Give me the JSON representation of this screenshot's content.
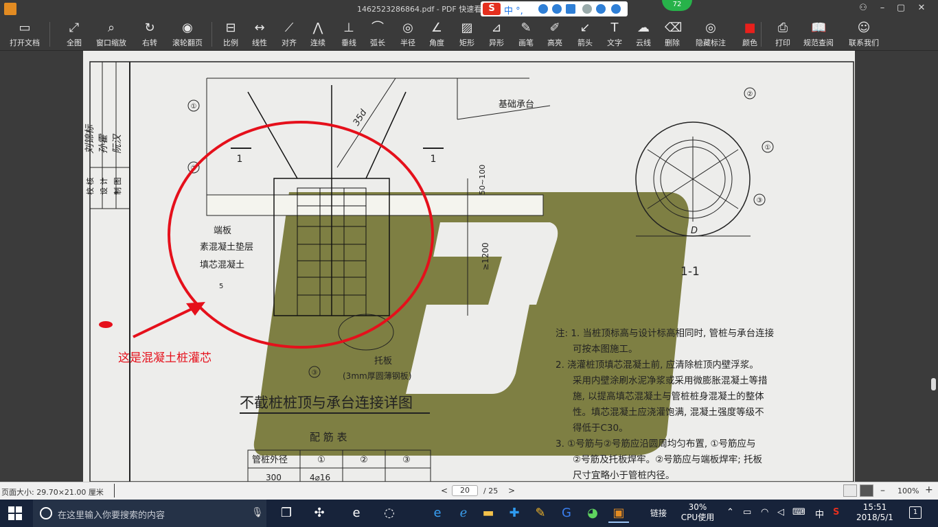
{
  "window": {
    "title": "1462523286864.pdf - PDF 快速看图",
    "badge_number": "72",
    "minimize_label": "–",
    "maximize_label": "▢",
    "close_label": "✕"
  },
  "ime": {
    "logo": "S",
    "mode": "中 °,"
  },
  "toolbar": {
    "buttons": [
      {
        "icon": "folder-icon",
        "glyph": "▭",
        "label": "打开文档"
      },
      {
        "icon": "fullview-icon",
        "glyph": "⤢",
        "label": "全图"
      },
      {
        "icon": "zoom-window-icon",
        "glyph": "⌕",
        "label": "窗口缩放"
      },
      {
        "icon": "rotate-icon",
        "glyph": "↻",
        "label": "右转"
      },
      {
        "icon": "mouse-icon",
        "glyph": "◉",
        "label": "滚轮翻页"
      },
      {
        "icon": "ruler-icon",
        "glyph": "⊟",
        "label": "比例"
      },
      {
        "icon": "linear-icon",
        "glyph": "↔",
        "label": "线性"
      },
      {
        "icon": "align-icon",
        "glyph": "⟋",
        "label": "对齐"
      },
      {
        "icon": "continuous-icon",
        "glyph": "⋀",
        "label": "连续"
      },
      {
        "icon": "perpendicular-icon",
        "glyph": "⊥",
        "label": "垂线"
      },
      {
        "icon": "arc-length-icon",
        "glyph": "⌒",
        "label": "弧长"
      },
      {
        "icon": "radius-icon",
        "glyph": "◎",
        "label": "半径"
      },
      {
        "icon": "angle-icon",
        "glyph": "∠",
        "label": "角度"
      },
      {
        "icon": "rectangle-icon",
        "glyph": "▨",
        "label": "矩形"
      },
      {
        "icon": "irregular-icon",
        "glyph": "⊿",
        "label": "异形"
      },
      {
        "icon": "pen-icon",
        "glyph": "✎",
        "label": "画笔"
      },
      {
        "icon": "highlight-icon",
        "glyph": "✐",
        "label": "高亮"
      },
      {
        "icon": "arrow-icon",
        "glyph": "↙",
        "label": "箭头"
      },
      {
        "icon": "text-icon",
        "glyph": "T",
        "label": "文字"
      },
      {
        "icon": "cloud-icon",
        "glyph": "☁",
        "label": "云线"
      },
      {
        "icon": "eraser-icon",
        "glyph": "⌫",
        "label": "删除"
      },
      {
        "icon": "hide-markup-icon",
        "glyph": "◎",
        "label": "隐藏标注"
      },
      {
        "icon": "color-icon",
        "glyph": "■",
        "label": "颜色"
      },
      {
        "icon": "print-icon",
        "glyph": "⎙",
        "label": "打印"
      },
      {
        "icon": "spec-search-icon",
        "glyph": "📖",
        "label": "规范查阅"
      },
      {
        "icon": "contact-icon",
        "glyph": "☺",
        "label": "联系我们"
      }
    ],
    "color_swatch": "#e8201c"
  },
  "drawing": {
    "title_block": [
      "校 核",
      "设 计",
      "制 图"
    ],
    "signatures": [
      "刘锦标",
      "孙霍",
      "阮汉"
    ],
    "callouts": [
      "①",
      "②",
      "③",
      "①",
      "②",
      "③"
    ],
    "section_mark": "1",
    "dim_35d": "35d",
    "dim_50_100": "50~100",
    "dim_1200": "≥1200",
    "label_cap": "基础承台",
    "label_endplate": "端板",
    "label_plain_concrete": "素混凝土垫层",
    "label_fill_concrete": "填芯混凝土",
    "label_tray": "托板",
    "label_tray_spec": "(3mm厚圆薄钢板)",
    "weld_mark": "5",
    "section_label": "1-1",
    "diameter_label": "D",
    "main_title": "不截桩桩顶与承台连接详图",
    "rebar_table_title": "配 筋 表",
    "rebar_table_headers": [
      "管桩外径",
      "①",
      "②",
      "③"
    ],
    "rebar_table_row": [
      "300",
      "4⌀16",
      "",
      ""
    ],
    "notes": [
      "注: 1. 当桩顶标高与设计标高相同时, 管桩与承台连接",
      "可按本图施工。",
      "2. 浇灌桩顶填芯混凝土前, 应清除桩顶内壁浮浆。",
      "采用内壁涂刷水泥净浆或采用微膨胀混凝土等措",
      "施, 以提高填芯混凝土与管桩桩身混凝土的整体",
      "性。填芯混凝土应浇灌饱满, 混凝土强度等级不",
      "得低于C30。",
      "3. ①号筋与②号筋应沿圆周均匀布置, ①号筋应与",
      "②号筋及托板焊牢。②号筋应与端板焊牢; 托板",
      "尺寸宜略小于管桩内径。"
    ],
    "watermark_color": "#6e6f2b"
  },
  "annotation": {
    "text": "这是混凝土桩灌芯",
    "color": "#e5101b"
  },
  "statusbar": {
    "page_size": "页面大小: 29.70×21.00 厘米",
    "current_page": "20",
    "total_pages": "/ 25",
    "prev": "<",
    "next": ">",
    "zoom": "100%",
    "zoom_out": "–",
    "zoom_in": "+"
  },
  "taskbar": {
    "search_placeholder": "在这里输入你要搜索的内容",
    "link_label": "链接",
    "cpu_percent": "30%",
    "cpu_label": "CPU使用",
    "ime_indicator": "中",
    "time": "15:51",
    "date": "2018/5/1",
    "notification_count": "1"
  }
}
